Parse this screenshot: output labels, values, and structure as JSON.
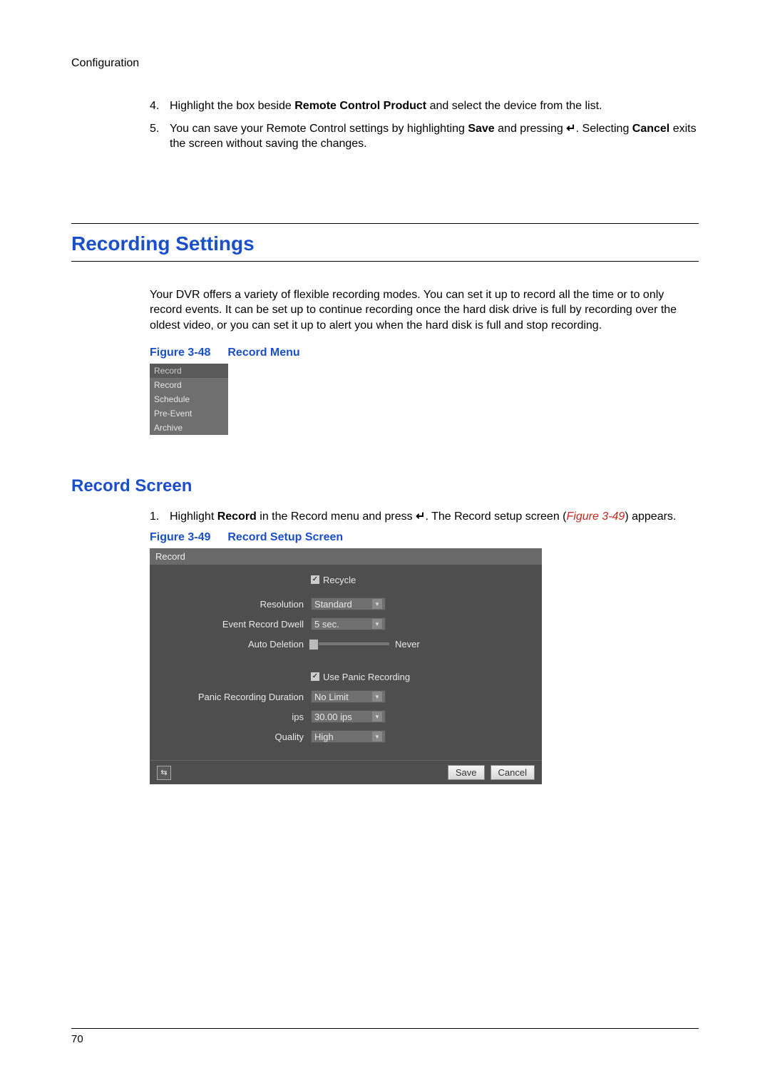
{
  "header": {
    "breadcrumb": "Configuration"
  },
  "step4": {
    "num": "4.",
    "pre": "Highlight the box beside ",
    "bold": "Remote Control Product",
    "post": " and select the device from the list."
  },
  "step5": {
    "num": "5.",
    "pre": "You can save your Remote Control settings by highlighting ",
    "bold1": "Save",
    "mid1": " and pressing ",
    "enter_glyph": "↵",
    "mid2": ". Selecting ",
    "bold2": "Cancel",
    "post": " exits the screen without saving the changes."
  },
  "section": {
    "title": "Recording Settings"
  },
  "intro_para": "Your DVR offers a variety of flexible recording modes. You can set it up to record all the time or to only record events. It can be set up to continue recording once the hard disk drive is full by recording over the oldest video, or you can set it up to alert you when the hard disk is full and stop recording.",
  "fig48": {
    "label": "Figure 3-48",
    "title": "Record Menu"
  },
  "record_menu": {
    "title": "Record",
    "items": [
      "Record",
      "Schedule",
      "Pre-Event",
      "Archive"
    ]
  },
  "subsection": {
    "title": "Record Screen"
  },
  "step1_rs": {
    "num": "1.",
    "pre": "Highlight ",
    "bold": "Record",
    "mid": " in the Record menu and press ",
    "enter_glyph": "↵",
    "mid2": ". The Record setup screen (",
    "ref": "Figure 3-49",
    "post": ") appears."
  },
  "fig49": {
    "label": "Figure 3-49",
    "title": "Record Setup Screen"
  },
  "setup": {
    "title": "Record",
    "recycle": "Recycle",
    "resolution_label": "Resolution",
    "resolution_value": "Standard",
    "event_dwell_label": "Event Record Dwell",
    "event_dwell_value": "5 sec.",
    "auto_del_label": "Auto Deletion",
    "auto_del_never": "Never",
    "use_panic": "Use Panic Recording",
    "panic_dur_label": "Panic Recording Duration",
    "panic_dur_value": "No Limit",
    "ips_label": "ips",
    "ips_value": "30.00 ips",
    "quality_label": "Quality",
    "quality_value": "High",
    "save": "Save",
    "cancel": "Cancel",
    "footer_icon_glyph": "⇆"
  },
  "page_number": "70"
}
